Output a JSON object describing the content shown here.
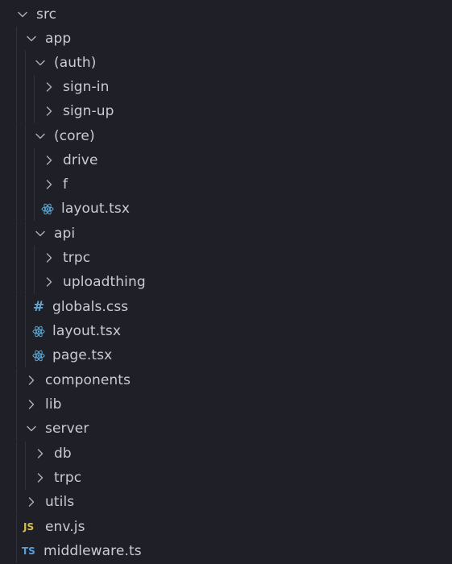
{
  "tree": [
    {
      "label": "src",
      "kind": "folder-open"
    },
    {
      "label": "app",
      "kind": "folder-open"
    },
    {
      "label": "(auth)",
      "kind": "folder-open"
    },
    {
      "label": "sign-in",
      "kind": "folder-closed"
    },
    {
      "label": "sign-up",
      "kind": "folder-closed"
    },
    {
      "label": "(core)",
      "kind": "folder-open"
    },
    {
      "label": "drive",
      "kind": "folder-closed"
    },
    {
      "label": "f",
      "kind": "folder-closed"
    },
    {
      "label": "layout.tsx",
      "kind": "react-file"
    },
    {
      "label": "api",
      "kind": "folder-open"
    },
    {
      "label": "trpc",
      "kind": "folder-closed"
    },
    {
      "label": "uploadthing",
      "kind": "folder-closed"
    },
    {
      "label": "globals.css",
      "kind": "css-file"
    },
    {
      "label": "layout.tsx",
      "kind": "react-file"
    },
    {
      "label": "page.tsx",
      "kind": "react-file"
    },
    {
      "label": "components",
      "kind": "folder-closed"
    },
    {
      "label": "lib",
      "kind": "folder-closed"
    },
    {
      "label": "server",
      "kind": "folder-open"
    },
    {
      "label": "db",
      "kind": "folder-closed"
    },
    {
      "label": "trpc",
      "kind": "folder-closed"
    },
    {
      "label": "utils",
      "kind": "folder-closed"
    },
    {
      "label": "env.js",
      "kind": "js-file",
      "badge": "JS"
    },
    {
      "label": "middleware.ts",
      "kind": "ts-file",
      "badge": "TS"
    }
  ],
  "colors": {
    "background": "#1e1f27",
    "text": "#c9ccd3",
    "chevron": "#aeb2bb",
    "react": "#5aa9d6",
    "css": "#62a8d6",
    "js": "#d7c04a",
    "ts": "#5a9fd6"
  }
}
